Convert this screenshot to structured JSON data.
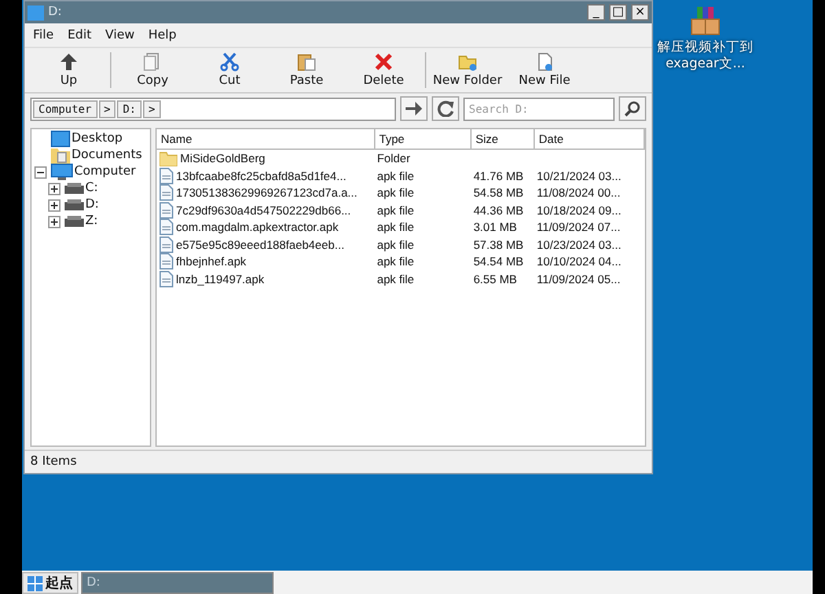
{
  "window": {
    "title": "D:",
    "controls": [
      "_",
      "□",
      "×"
    ]
  },
  "menu": [
    "File",
    "Edit",
    "View",
    "Help"
  ],
  "toolbar": [
    {
      "label": "Up"
    },
    {
      "label": "Copy"
    },
    {
      "label": "Cut"
    },
    {
      "label": "Paste"
    },
    {
      "label": "Delete"
    },
    {
      "label": "New Folder"
    },
    {
      "label": "New File"
    }
  ],
  "address": {
    "crumbs": [
      "Computer",
      "D:"
    ],
    "separator": ">",
    "search_placeholder": "Search D:"
  },
  "tree": [
    {
      "label": "Desktop",
      "kind": "desktop"
    },
    {
      "label": "Documents",
      "kind": "documents"
    },
    {
      "label": "Computer",
      "kind": "computer",
      "expanded": true,
      "children": [
        {
          "label": "C:",
          "kind": "drive",
          "expanded": false
        },
        {
          "label": "D:",
          "kind": "drive",
          "expanded": false
        },
        {
          "label": "Z:",
          "kind": "drive",
          "expanded": false
        }
      ]
    }
  ],
  "table": {
    "columns": [
      "Name",
      "Type",
      "Size",
      "Date"
    ],
    "rows": [
      {
        "kind": "folder",
        "name": "MiSideGoldBerg",
        "type": "Folder"
      },
      {
        "kind": "file",
        "name": "13bfcaabe8fc25cbafd8a5d1fe4...",
        "type": "apk file",
        "size": "41.76 MB",
        "date": "10/21/2024 03..."
      },
      {
        "kind": "file",
        "name": "173051383629969267123cd7a.a...",
        "type": "apk file",
        "size": "54.58 MB",
        "date": "11/08/2024 00..."
      },
      {
        "kind": "file",
        "name": "7c29df9630a4d547502229db66...",
        "type": "apk file",
        "size": "44.36 MB",
        "date": "10/18/2024 09..."
      },
      {
        "kind": "file",
        "name": "com.magdalm.apkextractor.apk",
        "type": "apk file",
        "size": "3.01 MB",
        "date": "11/09/2024 07..."
      },
      {
        "kind": "file",
        "name": "e575e95c89eeed188faeb4eeb...",
        "type": "apk file",
        "size": "57.38 MB",
        "date": "10/23/2024 03..."
      },
      {
        "kind": "file",
        "name": "fhbejnhef.apk",
        "type": "apk file",
        "size": "54.54 MB",
        "date": "10/10/2024 04..."
      },
      {
        "kind": "file",
        "name": "lnzb_119497.apk",
        "type": "apk file",
        "size": "6.55 MB",
        "date": "11/09/2024 05..."
      }
    ]
  },
  "status_bar": "8 Items",
  "desktop_icon": {
    "label": "解压视频补丁到exagear文..."
  },
  "taskbar": {
    "start": "起点",
    "tasks": [
      {
        "label": "D:"
      }
    ]
  }
}
